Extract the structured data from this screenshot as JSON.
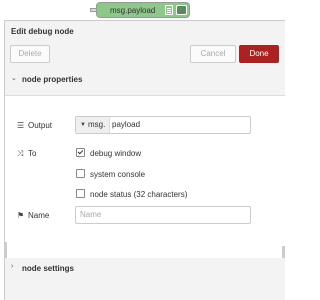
{
  "node_preview": {
    "label": "msg.payload",
    "color": "#8dc78a"
  },
  "tray": {
    "title": "Edit debug node",
    "buttons": {
      "delete": "Delete",
      "cancel": "Cancel",
      "done": "Done"
    }
  },
  "sections": {
    "properties": {
      "label": "node properties",
      "expanded": true
    },
    "settings": {
      "label": "node settings",
      "expanded": false
    }
  },
  "form": {
    "output": {
      "label": "Output",
      "type": "msg.",
      "value": "payload"
    },
    "to": {
      "label": "To",
      "options": [
        {
          "label": "debug window",
          "checked": true
        },
        {
          "label": "system console",
          "checked": false
        },
        {
          "label": "node status (32 characters)",
          "checked": false
        }
      ]
    },
    "name": {
      "label": "Name",
      "placeholder": "Name",
      "value": ""
    }
  },
  "colors": {
    "done_button": "#aa2222",
    "tray_background": "#f3f3f3"
  }
}
